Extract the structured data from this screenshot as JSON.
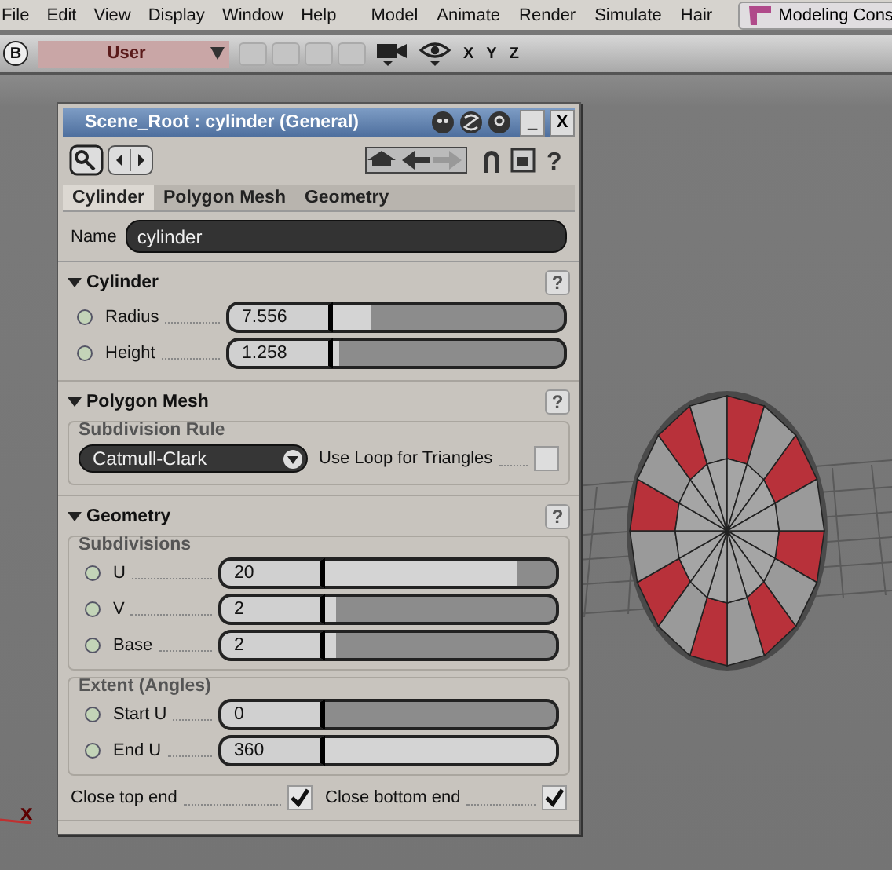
{
  "menu": [
    "File",
    "Edit",
    "View",
    "Display",
    "Window",
    "Help"
  ],
  "modules": [
    "Model",
    "Animate",
    "Render",
    "Simulate",
    "Hair"
  ],
  "layout_button": "Modeling Cons",
  "toolbar": {
    "badge": "B",
    "view": "User",
    "axes": [
      "X",
      "Y",
      "Z"
    ]
  },
  "viewport": {
    "axis_label": "x"
  },
  "dialog": {
    "title": "Scene_Root : cylinder (General)",
    "title_buttons": [
      "_",
      "X"
    ],
    "help": "?",
    "tabs": [
      {
        "label": "Cylinder",
        "selected": true
      },
      {
        "label": "Polygon Mesh",
        "selected": false
      },
      {
        "label": "Geometry",
        "selected": false
      }
    ],
    "name": {
      "label": "Name",
      "value": "cylinder"
    },
    "sections": [
      {
        "title": "Cylinder",
        "expanded": true,
        "help": "?",
        "groups": [
          {
            "rows": [
              {
                "kind": "slider",
                "label": "Radius",
                "value": "7.556",
                "level": 0.16
              },
              {
                "kind": "slider",
                "label": "Height",
                "value": "1.258",
                "level": 0.03
              }
            ]
          }
        ]
      },
      {
        "title": "Polygon Mesh",
        "expanded": true,
        "help": "?",
        "groups": [
          {
            "title": "Subdivision Rule",
            "rows": [
              {
                "kind": "dropdown",
                "value": "Catmull-Clark",
                "check_label": "Use Loop for Triangles",
                "checked": false
              }
            ]
          }
        ]
      },
      {
        "title": "Geometry",
        "expanded": true,
        "help": "?",
        "groups": [
          {
            "title": "Subdivisions",
            "rows": [
              {
                "kind": "slider",
                "label": "U",
                "value": "20",
                "level": 0.83
              },
              {
                "kind": "slider",
                "label": "V",
                "value": "2",
                "level": 0.05
              },
              {
                "kind": "slider",
                "label": "Base",
                "value": "2",
                "level": 0.05
              }
            ]
          },
          {
            "title": "Extent (Angles)",
            "rows": [
              {
                "kind": "slider",
                "label": "Start U",
                "value": "0",
                "level": 0
              },
              {
                "kind": "slider",
                "label": "End U",
                "value": "360",
                "level": 1
              }
            ]
          },
          {
            "rows": [
              {
                "kind": "checks",
                "items": [
                  {
                    "label": "Close top end",
                    "checked": true
                  },
                  {
                    "label": "Close bottom end",
                    "checked": true
                  }
                ]
              }
            ]
          }
        ]
      }
    ]
  }
}
